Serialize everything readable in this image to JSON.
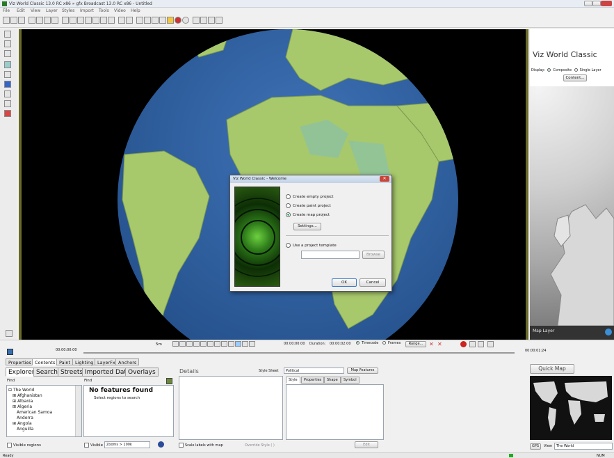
{
  "window": {
    "title": "Viz World Classic 13.0 RC x86 » gfx Broadcast 13.0 RC x86 - Untitled"
  },
  "menu": [
    "File",
    "Edit",
    "View",
    "Layer",
    "Styles",
    "Import",
    "Tools",
    "Video",
    "Help"
  ],
  "viewport": {
    "ocean_color": "#2f5f9e",
    "land_color": "#a8c86c"
  },
  "preview": {
    "title": "Viz World Classic",
    "display_label": "Display:",
    "composite": "Composite",
    "single_layer": "Single Layer",
    "content_button": "Content...",
    "map_layer": "Map Layer"
  },
  "dialog": {
    "title": "Viz World Classic - Welcome",
    "opt_empty": "Create empty project",
    "opt_paint": "Create paint project",
    "opt_map": "Create map project",
    "settings": "Settings...",
    "opt_template": "Use a project template",
    "browse": "Browse",
    "ok": "OK",
    "cancel": "Cancel"
  },
  "timeline": {
    "start": "00:00:00:00",
    "end": "00:00:01:24",
    "unit": "5m",
    "current": "00:00:00:00",
    "duration_label": "Duration:",
    "duration": "00:00:02:00",
    "timecode": "Timecode",
    "frames": "Frames",
    "range": "Range..."
  },
  "tabs_top": [
    "Properties",
    "Contents",
    "Paint",
    "Lighting",
    "LayerFx",
    "Anchors"
  ],
  "tabs_second": [
    "Explorer",
    "Search",
    "Streets",
    "Imported Data",
    "Overlays"
  ],
  "explorer": {
    "find_label": "Find",
    "tree": [
      "The World",
      "Afghanistan",
      "Albania",
      "Algeria",
      "American Samoa",
      "Andorra",
      "Angola",
      "Anguilla"
    ],
    "no_features": "No features found",
    "select_hint": "Select regions to search",
    "visible_regions": "Visible regions",
    "visible": "Visible",
    "zoom": "Zooms > 100k"
  },
  "details": {
    "title": "Details",
    "style_sheet_label": "Style Sheet",
    "style_sheet_value": "Political",
    "map_features": "Map Features",
    "subtabs": [
      "Style",
      "Properties",
      "Shape",
      "Symbol"
    ],
    "scale_labels": "Scale labels with map",
    "override": "Override Style ( )",
    "edit": "Edit"
  },
  "quickmap": {
    "button": "Quick Map",
    "gps": "GPS",
    "view_label": "View",
    "view_value": "The World"
  },
  "status": {
    "left": "Ready",
    "right": "NUM"
  }
}
